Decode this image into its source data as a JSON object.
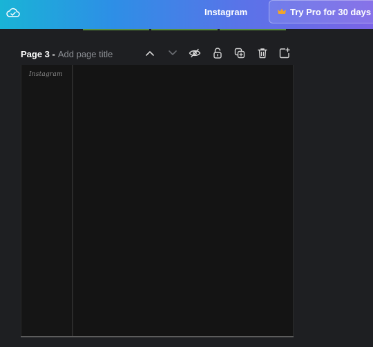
{
  "topbar": {
    "design_name": "Instagram",
    "pro_label": "Try Pro for 30 days",
    "colors": {
      "gradient_start": "#19b4d6",
      "gradient_end": "#7a63e6",
      "crown": "#f5a623"
    }
  },
  "page": {
    "label": "Page 3 -",
    "title_placeholder": "Add page title",
    "controls": [
      "chevron-up-icon",
      "chevron-down-icon",
      "hide-icon",
      "lock-icon",
      "duplicate-icon",
      "trash-icon",
      "add-page-icon"
    ]
  },
  "canvas": {
    "brand_text": "Instagram"
  }
}
